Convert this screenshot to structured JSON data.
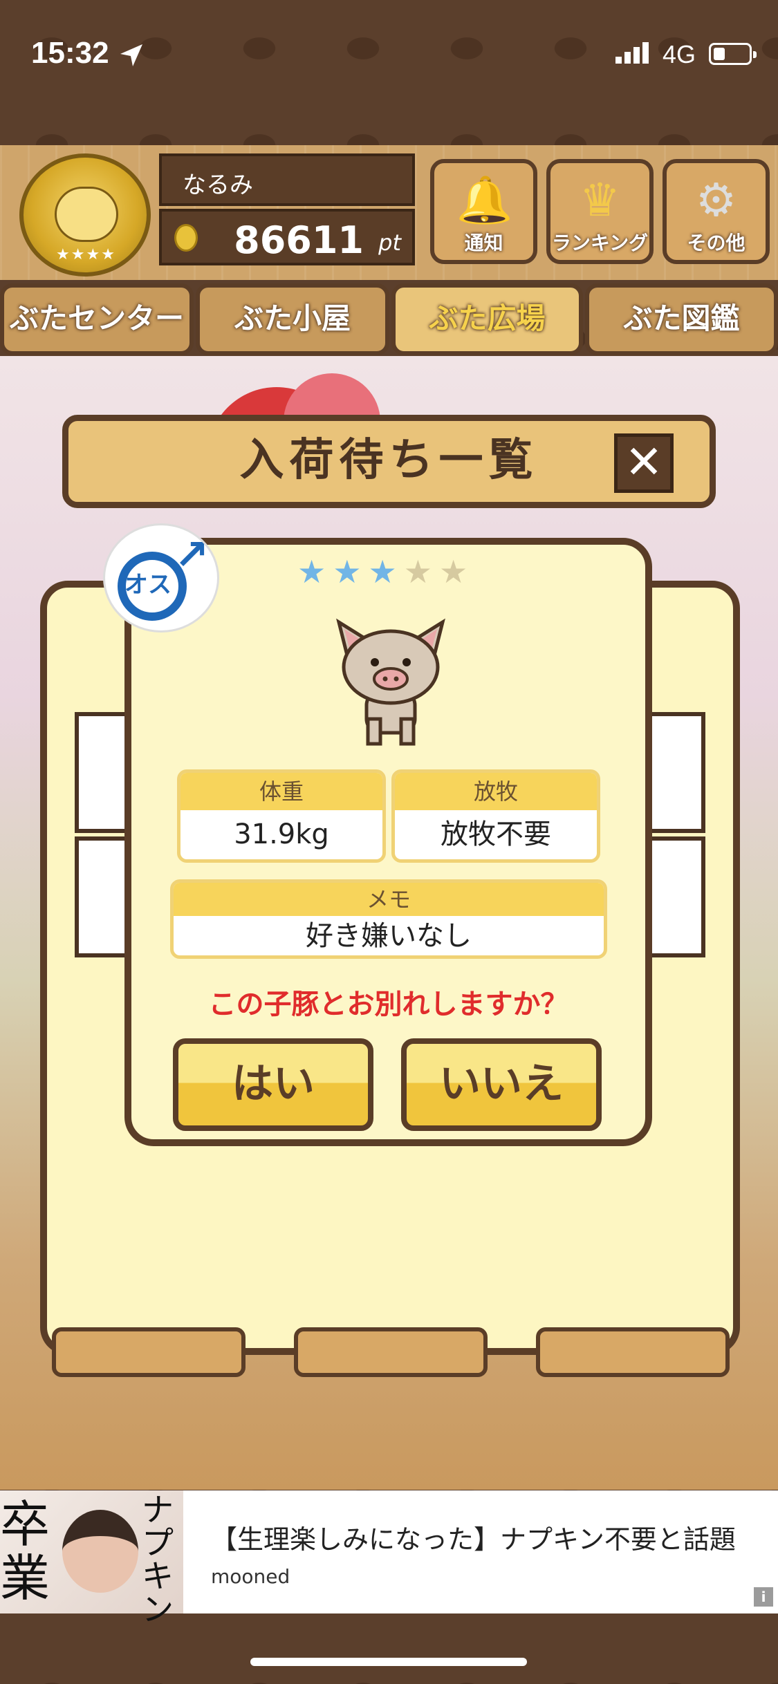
{
  "status_bar": {
    "time": "15:32",
    "network": "4G"
  },
  "header": {
    "username": "なるみ",
    "points": "86611",
    "points_unit": "pt",
    "buttons": [
      {
        "label": "通知",
        "icon": "bell-icon"
      },
      {
        "label": "ランキング",
        "icon": "crown-icon"
      },
      {
        "label": "その他",
        "icon": "gear-icon"
      }
    ]
  },
  "nav_tabs": [
    {
      "label": "ぶたセンター",
      "active": false
    },
    {
      "label": "ぶた小屋",
      "active": false
    },
    {
      "label": "ぶた広場",
      "active": true
    },
    {
      "label": "ぶた図鑑",
      "active": false
    }
  ],
  "panel": {
    "title": "入荷待ち一覧",
    "close_symbol": "✕"
  },
  "dialog": {
    "gender_label": "オス",
    "rating": {
      "filled": 3,
      "total": 5
    },
    "weight_label": "体重",
    "weight_value": "31.9kg",
    "graze_label": "放牧",
    "graze_value": "放牧不要",
    "memo_label": "メモ",
    "memo_value": "好き嫌いなし",
    "question": "この子豚とお別れしますか？",
    "yes_label": "はい",
    "no_label": "いいえ"
  },
  "ad": {
    "title": "【生理楽しみになった】ナプキン不要と話題",
    "advertiser": "mooned",
    "image_text_1": "卒業",
    "image_text_2": "ナプキン",
    "info_symbol": "i"
  },
  "colors": {
    "brown": "#5a3d27",
    "yellow": "#f7d45b",
    "red_text": "#e02c2c",
    "blue_male": "#1f68b8"
  }
}
